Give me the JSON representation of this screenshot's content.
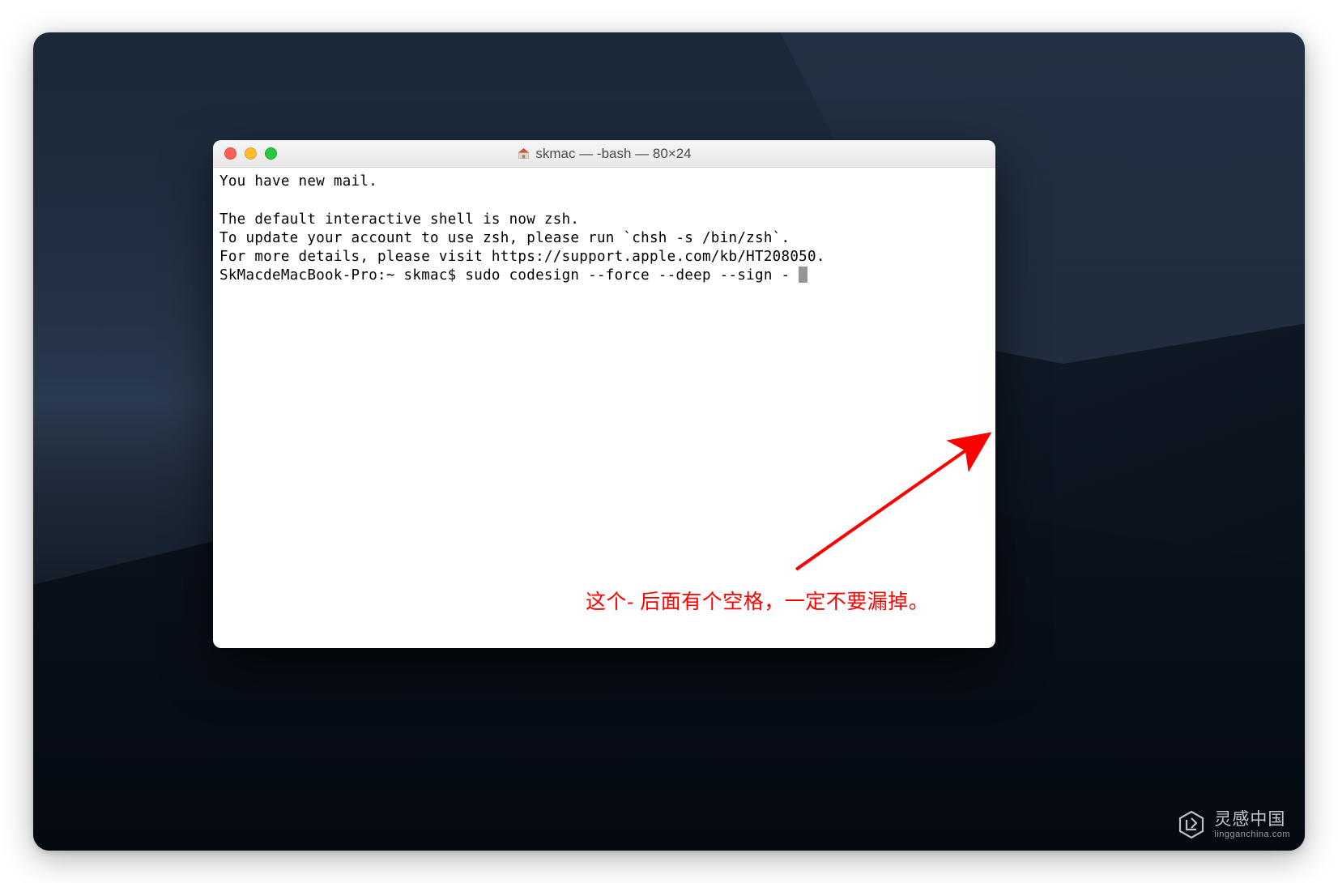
{
  "window": {
    "title": "skmac — -bash — 80×24"
  },
  "terminal": {
    "line1": "You have new mail.",
    "line2": "",
    "line3": "The default interactive shell is now zsh.",
    "line4": "To update your account to use zsh, please run `chsh -s /bin/zsh`.",
    "line5": "For more details, please visit https://support.apple.com/kb/HT208050.",
    "prompt": "SkMacdeMacBook-Pro:~ skmac$ ",
    "command": "sudo codesign --force --deep --sign - "
  },
  "annotation": {
    "text": "这个- 后面有个空格，一定不要漏掉。"
  },
  "watermark": {
    "cn": "灵感中国",
    "en": "lingganchina.com"
  }
}
